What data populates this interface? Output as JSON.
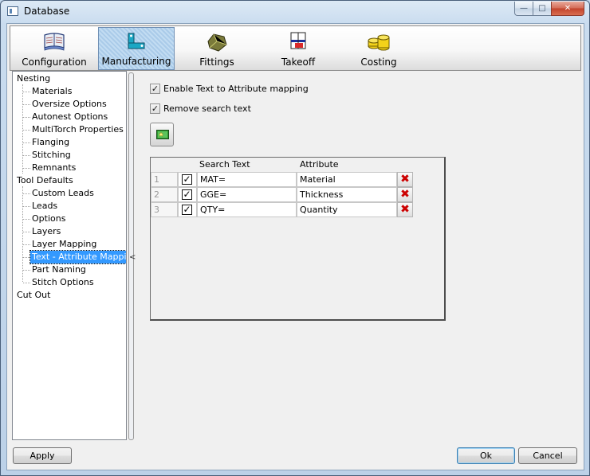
{
  "window": {
    "title": "Database"
  },
  "toolbar": {
    "items": [
      {
        "label": "Configuration"
      },
      {
        "label": "Manufacturing",
        "active": true
      },
      {
        "label": "Fittings"
      },
      {
        "label": "Takeoff"
      },
      {
        "label": "Costing"
      }
    ]
  },
  "tree": {
    "nesting": "Nesting",
    "materials": "Materials",
    "oversize": "Oversize Options",
    "autonest": "Autonest Options",
    "multitorch": "MultiTorch Properties",
    "flanging": "Flanging",
    "stitching": "Stitching",
    "remnants": "Remnants",
    "tool_defaults": "Tool Defaults",
    "custom_leads": "Custom Leads",
    "leads": "Leads",
    "options": "Options",
    "layers": "Layers",
    "layer_mapping": "Layer Mapping",
    "text_attr": "Text - Attribute Mapping",
    "part_naming": "Part Naming",
    "stitch_options": "Stitch Options",
    "cut_out": "Cut Out",
    "selected": "Text - Attribute Mapping"
  },
  "splitter": {
    "arrow": "<"
  },
  "options": {
    "enable_label": "Enable Text to Attribute mapping",
    "enable_checked": true,
    "remove_label": "Remove search text",
    "remove_checked": true
  },
  "grid": {
    "headers": {
      "search": "Search Text",
      "attribute": "Attribute"
    },
    "rows": [
      {
        "num": "1",
        "checked": true,
        "search": "MAT=",
        "attribute": "Material"
      },
      {
        "num": "2",
        "checked": true,
        "search": "GGE=",
        "attribute": "Thickness"
      },
      {
        "num": "3",
        "checked": true,
        "search": "QTY=",
        "attribute": "Quantity"
      }
    ]
  },
  "buttons": {
    "apply": "Apply",
    "ok": "Ok",
    "cancel": "Cancel"
  },
  "colors": {
    "selection": "#3399ff",
    "delete": "#cc0000"
  }
}
